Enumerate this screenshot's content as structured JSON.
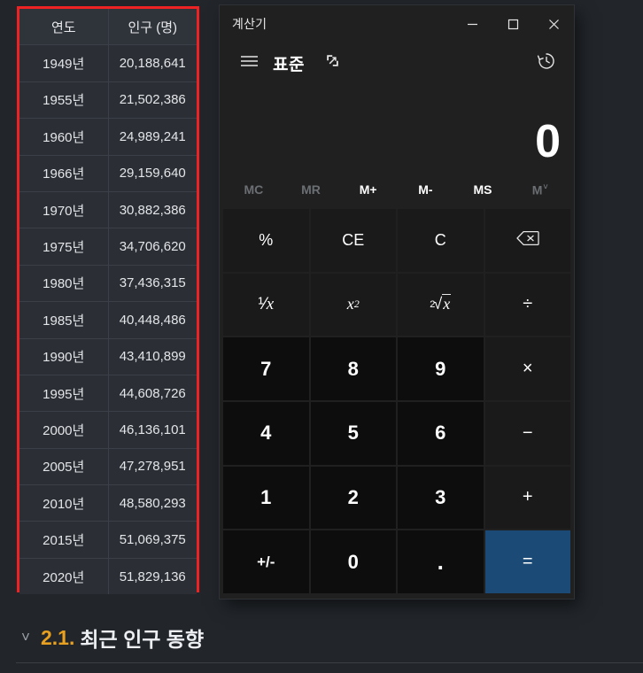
{
  "page": {
    "background_color": "#22262b"
  },
  "table": {
    "highlight_color": "#ee2222",
    "headers": [
      "연도",
      "인구 (명)"
    ],
    "rows": [
      {
        "year": "1949년",
        "population": "20,188,641"
      },
      {
        "year": "1955년",
        "population": "21,502,386"
      },
      {
        "year": "1960년",
        "population": "24,989,241"
      },
      {
        "year": "1966년",
        "population": "29,159,640"
      },
      {
        "year": "1970년",
        "population": "30,882,386"
      },
      {
        "year": "1975년",
        "population": "34,706,620"
      },
      {
        "year": "1980년",
        "population": "37,436,315"
      },
      {
        "year": "1985년",
        "population": "40,448,486"
      },
      {
        "year": "1990년",
        "population": "43,410,899"
      },
      {
        "year": "1995년",
        "population": "44,608,726"
      },
      {
        "year": "2000년",
        "population": "46,136,101"
      },
      {
        "year": "2005년",
        "population": "47,278,951"
      },
      {
        "year": "2010년",
        "population": "48,580,293"
      },
      {
        "year": "2015년",
        "population": "51,069,375"
      },
      {
        "year": "2020년",
        "population": "51,829,136"
      }
    ]
  },
  "calculator": {
    "title": "계산기",
    "window_controls": {
      "minimize": "minimize-icon",
      "maximize": "maximize-icon",
      "close": "close-icon"
    },
    "nav": {
      "menu_icon": "hamburger-menu-icon",
      "mode_label": "표준",
      "pin_icon": "keep-on-top-icon",
      "history_icon": "history-clock-icon"
    },
    "display": {
      "value": "0"
    },
    "memory": [
      {
        "label": "MC",
        "enabled": false
      },
      {
        "label": "MR",
        "enabled": false
      },
      {
        "label": "M+",
        "enabled": true
      },
      {
        "label": "M-",
        "enabled": true
      },
      {
        "label": "MS",
        "enabled": true
      },
      {
        "label": "M",
        "enabled": false,
        "has_chevron": true
      }
    ],
    "keys": {
      "percent": "%",
      "clear_entry": "CE",
      "clear": "C",
      "backspace": "backspace-icon",
      "reciprocal": "1/x",
      "square": "x²",
      "square_root": "²√x",
      "divide": "÷",
      "seven": "7",
      "eight": "8",
      "nine": "9",
      "multiply": "×",
      "four": "4",
      "five": "5",
      "six": "6",
      "subtract": "−",
      "one": "1",
      "two": "2",
      "three": "3",
      "add": "+",
      "sign": "+/-",
      "zero": "0",
      "decimal": ".",
      "equals": "="
    },
    "equals_color": "#1a4a75"
  },
  "section": {
    "toggle_icon": "chevron-down-icon",
    "number": "2.1.",
    "title": "최근 인구 동향",
    "number_color": "#e8a020"
  }
}
